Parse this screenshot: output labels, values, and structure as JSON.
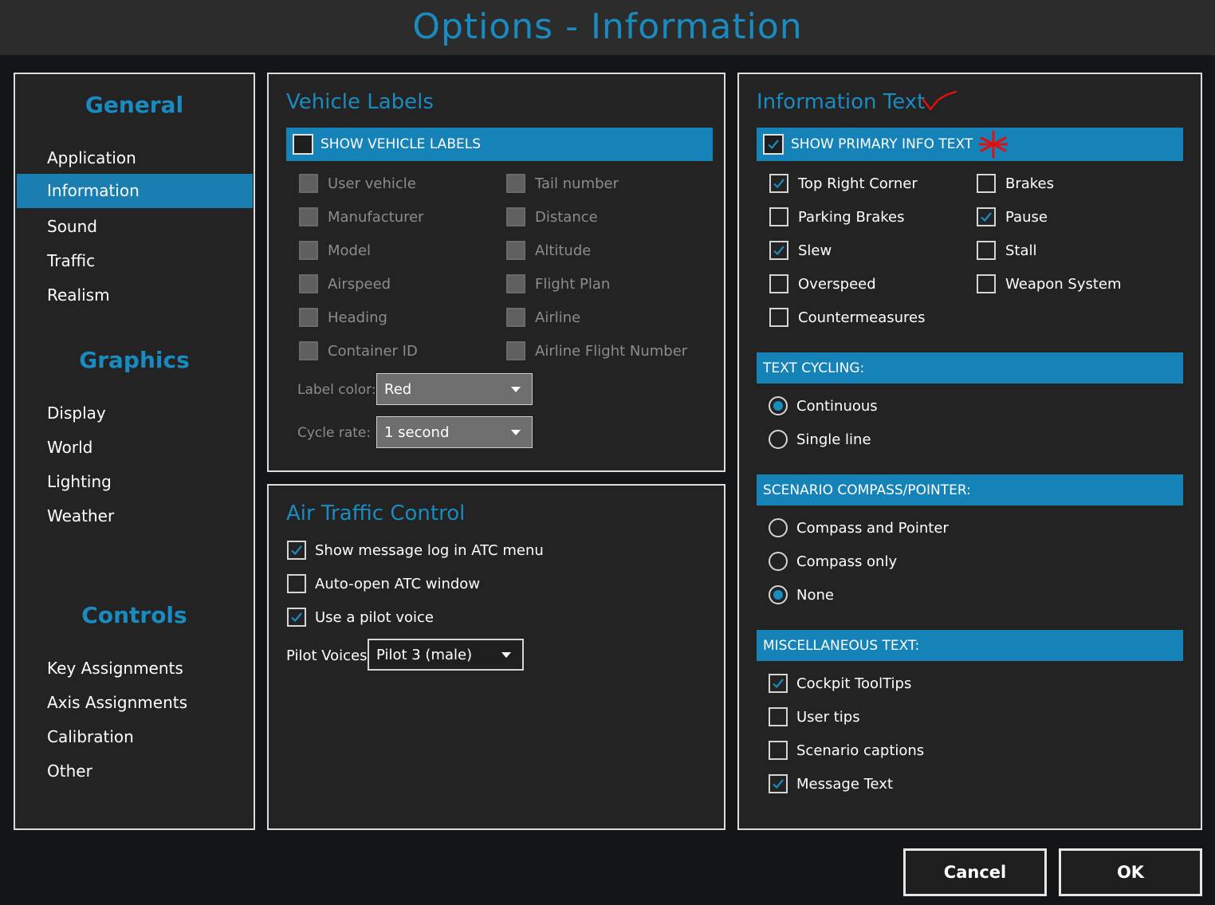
{
  "window": {
    "title": "Options - Information"
  },
  "nav": {
    "sections": [
      {
        "title": "General",
        "items": [
          "Application",
          "Information",
          "Sound",
          "Traffic",
          "Realism"
        ]
      },
      {
        "title": "Graphics",
        "items": [
          "Display",
          "World",
          "Lighting",
          "Weather"
        ]
      },
      {
        "title": "Controls",
        "items": [
          "Key Assignments",
          "Axis Assignments",
          "Calibration",
          "Other"
        ]
      }
    ],
    "active_item": "Information"
  },
  "vehicle_labels": {
    "title": "Vehicle Labels",
    "show_label": "SHOW VEHICLE LABELS",
    "show_checked": false,
    "options": [
      {
        "label": "User vehicle",
        "checked": false
      },
      {
        "label": "Tail number",
        "checked": false
      },
      {
        "label": "Manufacturer",
        "checked": false
      },
      {
        "label": "Distance",
        "checked": false
      },
      {
        "label": "Model",
        "checked": false
      },
      {
        "label": "Altitude",
        "checked": false
      },
      {
        "label": "Airspeed",
        "checked": false
      },
      {
        "label": "Flight Plan",
        "checked": false
      },
      {
        "label": "Heading",
        "checked": false
      },
      {
        "label": "Airline",
        "checked": false
      },
      {
        "label": "Container ID",
        "checked": false
      },
      {
        "label": "Airline Flight Number",
        "checked": false
      }
    ],
    "label_color_label": "Label color:",
    "label_color_value": "Red",
    "cycle_rate_label": "Cycle rate:",
    "cycle_rate_value": "1 second"
  },
  "atc": {
    "title": "Air Traffic Control",
    "options": [
      {
        "label": "Show message log in ATC menu",
        "checked": true
      },
      {
        "label": "Auto-open ATC window",
        "checked": false
      },
      {
        "label": "Use a pilot voice",
        "checked": true
      }
    ],
    "pilot_voices_label": "Pilot Voices:",
    "pilot_voices_value": "Pilot 3 (male)"
  },
  "info_text": {
    "title": "Information Text",
    "show_primary_label": "SHOW PRIMARY INFO TEXT",
    "show_primary_checked": true,
    "options": [
      {
        "label": "Top Right Corner",
        "checked": true
      },
      {
        "label": "Brakes",
        "checked": false
      },
      {
        "label": "Parking Brakes",
        "checked": false
      },
      {
        "label": "Pause",
        "checked": true
      },
      {
        "label": "Slew",
        "checked": true
      },
      {
        "label": "Stall",
        "checked": false
      },
      {
        "label": "Overspeed",
        "checked": false
      },
      {
        "label": "Weapon System",
        "checked": false
      },
      {
        "label": "Countermeasures",
        "checked": false
      }
    ],
    "text_cycling": {
      "header": "TEXT CYCLING:",
      "options": [
        {
          "label": "Continuous",
          "selected": true
        },
        {
          "label": "Single line",
          "selected": false
        }
      ]
    },
    "compass": {
      "header": "SCENARIO COMPASS/POINTER:",
      "options": [
        {
          "label": "Compass and Pointer",
          "selected": false
        },
        {
          "label": "Compass only",
          "selected": false
        },
        {
          "label": "None",
          "selected": true
        }
      ]
    },
    "misc": {
      "header": "MISCELLANEOUS TEXT:",
      "options": [
        {
          "label": "Cockpit ToolTips",
          "checked": true
        },
        {
          "label": "User tips",
          "checked": false
        },
        {
          "label": "Scenario captions",
          "checked": false
        },
        {
          "label": "Message Text",
          "checked": true
        }
      ]
    }
  },
  "footer": {
    "cancel_label": "Cancel",
    "ok_label": "OK"
  },
  "colors": {
    "accent": "#1a8bc1",
    "bar": "#1583b8",
    "annotation": "#e01010"
  }
}
